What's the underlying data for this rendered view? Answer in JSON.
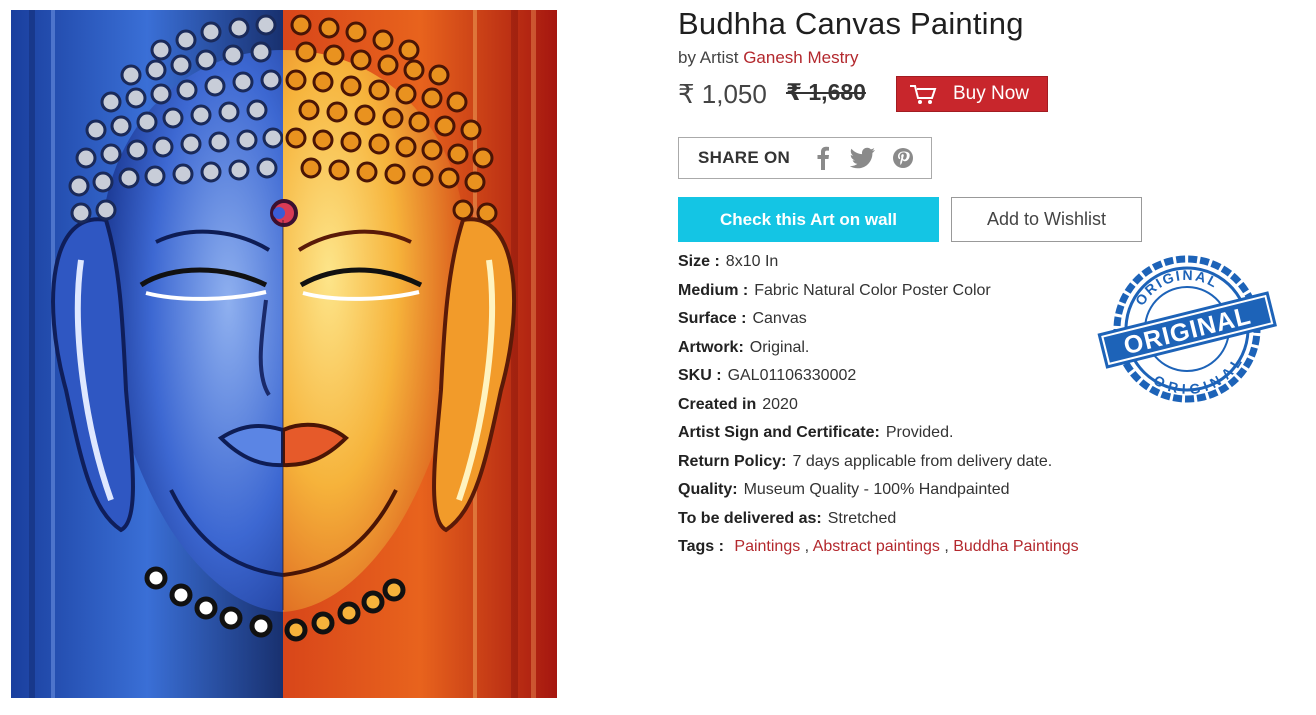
{
  "product": {
    "title": "Budhha Canvas Painting",
    "artist_prefix": "by Artist",
    "artist_name": "Ganesh Mestry",
    "price": "₹ 1,050",
    "old_price": "₹ 1,680",
    "buy_label": "Buy Now"
  },
  "share": {
    "label": "SHARE ON",
    "icons": [
      "facebook-icon",
      "twitter-icon",
      "pinterest-icon"
    ]
  },
  "actions": {
    "wall_label": "Check this Art on wall",
    "wishlist_label": "Add to Wishlist"
  },
  "specs": [
    {
      "key": "Size :",
      "value": "8x10 In"
    },
    {
      "key": "Medium :",
      "value": "Fabric Natural Color Poster Color"
    },
    {
      "key": "Surface :",
      "value": "Canvas"
    },
    {
      "key": "Artwork:",
      "value": "Original."
    },
    {
      "key": "SKU :",
      "value": "GAL01106330002"
    },
    {
      "key": "Created in",
      "value": "2020"
    },
    {
      "key": "Artist Sign and Certificate:",
      "value": "Provided."
    },
    {
      "key": "Return Policy:",
      "value": "7 days applicable from delivery date."
    },
    {
      "key": "Quality:",
      "value": "Museum Quality - 100% Handpainted"
    },
    {
      "key": "To be delivered as:",
      "value": "Stretched"
    }
  ],
  "tags": {
    "label": "Tags :",
    "items": [
      "Paintings",
      "Abstract paintings",
      "Buddha Paintings"
    ],
    "separator": ","
  },
  "stamp": {
    "main": "ORIGINAL",
    "top": "ORIGINAL",
    "bottom": "ORIGINAL"
  },
  "colors": {
    "accent_red": "#c8262c",
    "link_red": "#b3282d",
    "cyan": "#14c5e4",
    "stamp_blue": "#1d63b8"
  }
}
